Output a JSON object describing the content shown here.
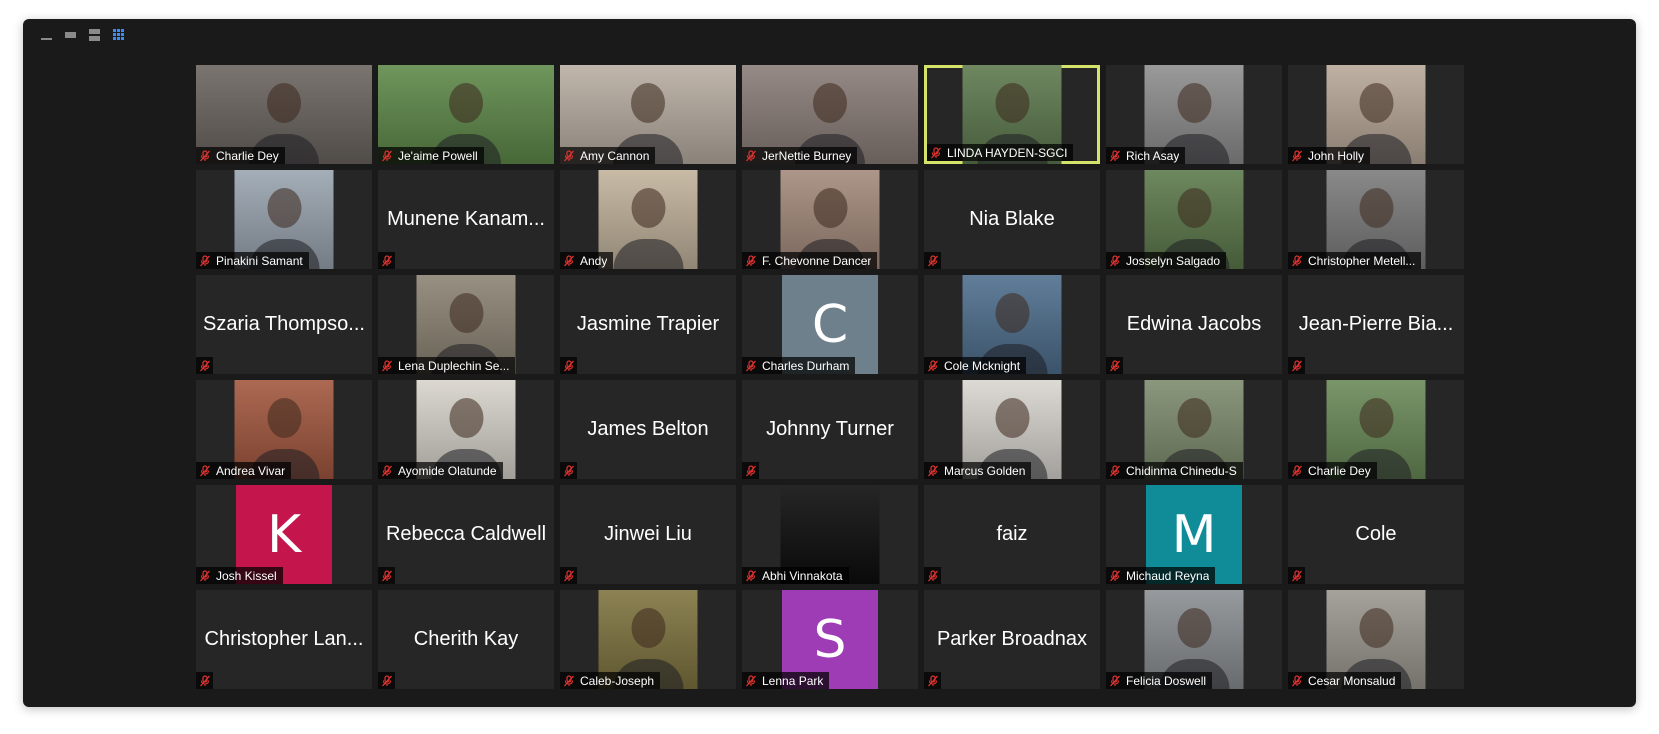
{
  "colors": {
    "window_bg": "#1a1a1a",
    "tile_bg": "#262626",
    "active_border": "#d6e36a",
    "muted_red": "#e0332f",
    "gallery_icon": "#3d8af7"
  },
  "toolbar": {
    "icons": [
      "minimize-icon",
      "strip-view-icon",
      "speaker-view-icon",
      "gallery-view-icon"
    ]
  },
  "participants": [
    {
      "name": "Charlie Dey",
      "video": true,
      "bg": "#6b6560",
      "wide": true
    },
    {
      "name": "Je'aime Powell",
      "video": true,
      "bg": "#5f8a4a",
      "wide": true
    },
    {
      "name": "Amy Cannon",
      "video": true,
      "bg": "#b9aea3",
      "wide": true
    },
    {
      "name": "JerNettie Burney",
      "video": true,
      "bg": "#8a7d78",
      "wide": true
    },
    {
      "name": "LINDA HAYDEN-SGCI",
      "video": true,
      "bg": "#5e7a4f",
      "active": true
    },
    {
      "name": "Rich Asay",
      "video": true,
      "bg": "#8e8e8e"
    },
    {
      "name": "John Holly",
      "video": true,
      "bg": "#b8a898"
    },
    {
      "name": "Pinakini Samant",
      "video": true,
      "bg": "#9aa5b0"
    },
    {
      "name": "Munene Kanam...",
      "video": false
    },
    {
      "name": "Andy",
      "video": true,
      "bg": "#c2b39c"
    },
    {
      "name": "F. Chevonne Dancer",
      "video": true,
      "bg": "#a48a7c"
    },
    {
      "name": "Nia Blake",
      "video": false
    },
    {
      "name": "Josselyn Salgado",
      "video": true,
      "bg": "#5d7a4c"
    },
    {
      "name": "Christopher Metell...",
      "video": true,
      "bg": "#7c7c7c"
    },
    {
      "name": "Szaria Thompso...",
      "video": false
    },
    {
      "name": "Lena Duplechin Se...",
      "video": true,
      "bg": "#8c8474"
    },
    {
      "name": "Jasmine Trapier",
      "video": false
    },
    {
      "name": "Charles Durham",
      "avatar": "C",
      "avatar_color": "#6f808d"
    },
    {
      "name": "Cole Mcknight",
      "video": true,
      "bg": "#4f6f8e"
    },
    {
      "name": "Edwina Jacobs",
      "video": false
    },
    {
      "name": "Jean-Pierre Bia...",
      "video": false
    },
    {
      "name": "Andrea Vivar",
      "video": true,
      "bg": "#a3583f"
    },
    {
      "name": "Ayomide Olatunde",
      "video": true,
      "bg": "#d8d4cc"
    },
    {
      "name": "James Belton",
      "video": false
    },
    {
      "name": "Johnny Turner",
      "video": false
    },
    {
      "name": "Marcus Golden",
      "video": true,
      "bg": "#d9d6d0"
    },
    {
      "name": "Chidinma Chinedu-S",
      "video": true,
      "bg": "#7e8c6e"
    },
    {
      "name": "Charlie Dey",
      "video": true,
      "bg": "#6a8a58"
    },
    {
      "name": "Josh Kissel",
      "avatar": "K",
      "avatar_color": "#c4164d"
    },
    {
      "name": "Rebecca Caldwell",
      "video": false
    },
    {
      "name": "Jinwei Liu",
      "video": false
    },
    {
      "name": "Abhi Vinnakota",
      "video": true,
      "bg": "#0d0d0d"
    },
    {
      "name": "faiz",
      "video": false
    },
    {
      "name": "Michaud Reyna",
      "avatar": "M",
      "avatar_color": "#0f8c98"
    },
    {
      "name": "Cole",
      "video": false
    },
    {
      "name": "Christopher Lan...",
      "video": false
    },
    {
      "name": "Cherith Kay",
      "video": false
    },
    {
      "name": "Caleb-Joseph",
      "video": true,
      "bg": "#7f7440"
    },
    {
      "name": "Lenna Park",
      "avatar": "S",
      "avatar_color": "#9d3cb4"
    },
    {
      "name": "Parker Broadnax",
      "video": false
    },
    {
      "name": "Felicia Doswell",
      "video": true,
      "bg": "#8a8f93"
    },
    {
      "name": "Cesar Monsalud",
      "video": true,
      "bg": "#9c9890"
    }
  ]
}
